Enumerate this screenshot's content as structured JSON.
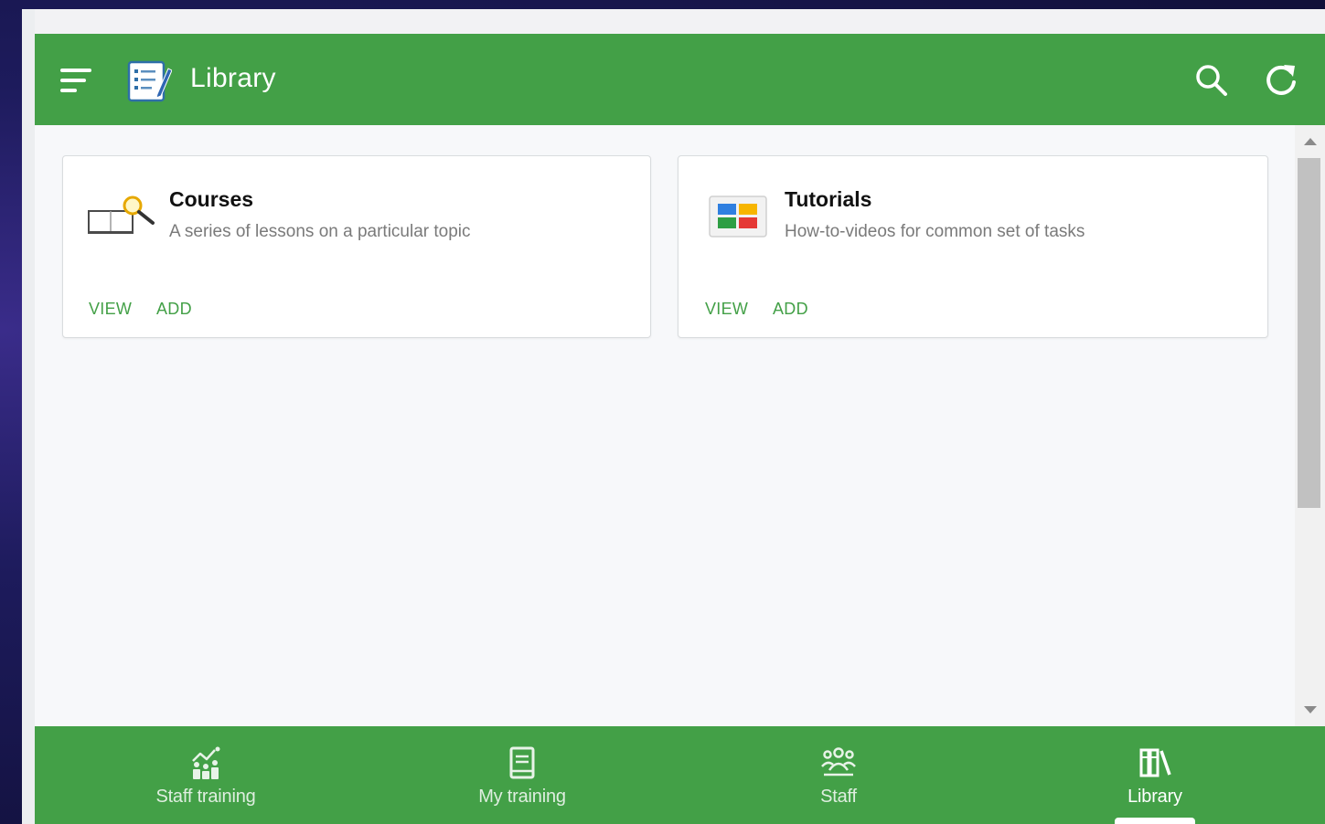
{
  "app": {
    "title": "Library",
    "accent_color": "#43a047",
    "menu_icon": "hamburger-icon",
    "logo_icon": "notepad-checklist-icon",
    "search_icon": "search-icon",
    "refresh_icon": "refresh-icon"
  },
  "cards": [
    {
      "title": "Courses",
      "description": "A series of lessons on a particular topic",
      "icon": "book-magnifier-icon",
      "actions": [
        "VIEW",
        "ADD"
      ]
    },
    {
      "title": "Tutorials",
      "description": "How-to-videos for common set of tasks",
      "icon": "color-tiles-icon",
      "actions": [
        "VIEW",
        "ADD"
      ]
    }
  ],
  "bottom_nav": [
    {
      "label": "Staff training",
      "icon": "chart-people-icon",
      "active": false
    },
    {
      "label": "My training",
      "icon": "document-icon",
      "active": false
    },
    {
      "label": "Staff",
      "icon": "group-icon",
      "active": false
    },
    {
      "label": "Library",
      "icon": "books-icon",
      "active": true
    }
  ]
}
